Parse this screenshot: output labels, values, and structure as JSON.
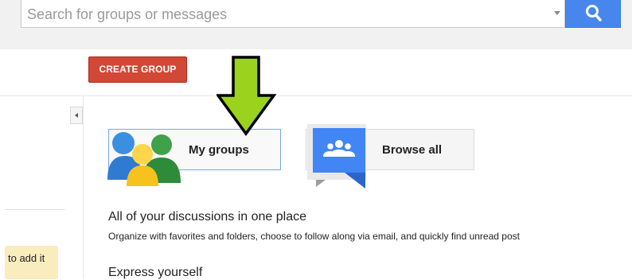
{
  "search": {
    "placeholder": "Search for groups or messages"
  },
  "toolbar": {
    "create_group_label": "CREATE GROUP"
  },
  "cards": {
    "my_groups_label": "My groups",
    "browse_all_label": "Browse all"
  },
  "sidebar": {
    "hint_text": "to add it"
  },
  "intro": {
    "heading_1": "All of your discussions in one place",
    "description_1": "Organize with favorites and folders, choose to follow along via email, and quickly find unread post",
    "heading_2": "Express yourself"
  },
  "colors": {
    "accent_blue": "#4787ed",
    "create_red": "#d14836",
    "annotation_arrow": "#9bd21e",
    "hint_yellow": "#f9edbe"
  },
  "icons": {
    "search": "search-icon",
    "caret": "chevron-down-icon",
    "collapse": "chevron-left-icon",
    "people": "people-icon",
    "browse": "browse-groups-icon",
    "annotation": "arrow-down-icon"
  }
}
